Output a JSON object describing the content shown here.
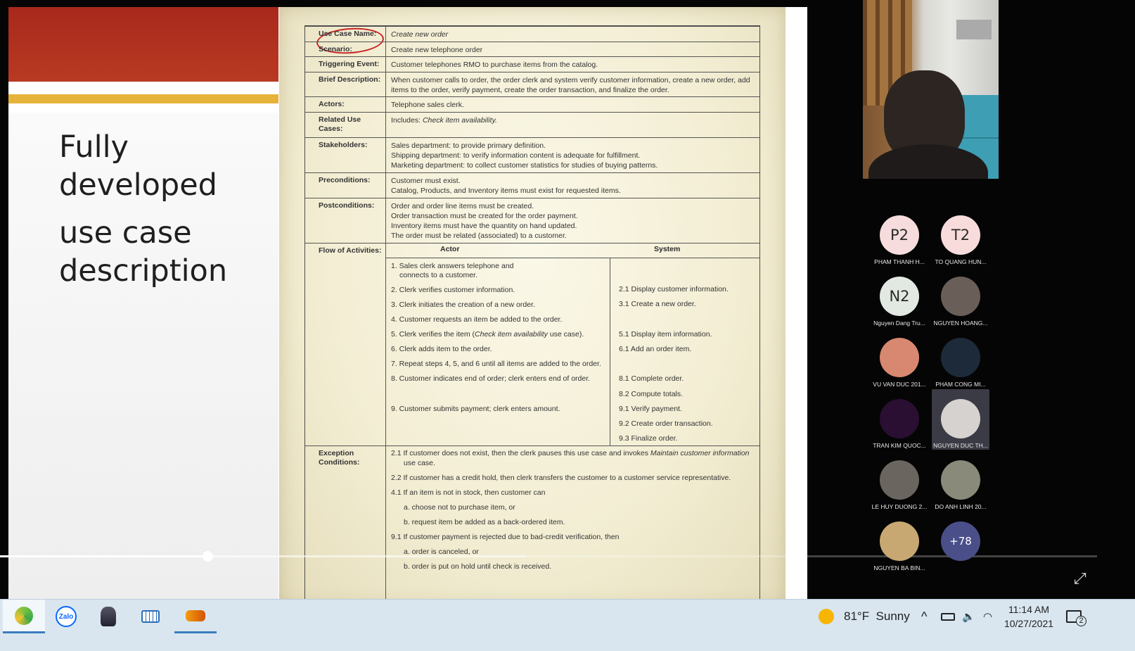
{
  "slide": {
    "title_line1": "Fully",
    "title_line2": "developed",
    "title_line3": "use case",
    "title_line4": "description"
  },
  "doc": {
    "use_case_name_label": "Use Case Name:",
    "use_case_name_value": "Create new order",
    "scenario_label": "Scenario:",
    "scenario_value": "Create new telephone order",
    "trigger_label": "Triggering Event:",
    "trigger_value": "Customer telephones RMO to purchase items from the catalog.",
    "brief_label": "Brief Description:",
    "brief_value": "When customer calls to order, the order clerk and system verify customer information, create a new order, add items to the order, verify payment, create the order transaction, and finalize the order.",
    "actors_label": "Actors:",
    "actors_value": "Telephone sales clerk.",
    "related_label": "Related Use Cases:",
    "related_prefix": "Includes: ",
    "related_value": "Check item availability.",
    "stakeholders_label": "Stakeholders:",
    "stakeholders": [
      "Sales department: to provide primary definition.",
      "Shipping department: to verify information content is adequate for fulfillment.",
      "Marketing department: to collect customer statistics for studies of buying patterns."
    ],
    "pre_label": "Preconditions:",
    "preconditions": [
      "Customer must exist.",
      "Catalog, Products, and Inventory items must exist for requested items."
    ],
    "post_label": "Postconditions:",
    "postconditions": [
      "Order and order line items must be created.",
      "Order transaction must be created for the order payment.",
      "Inventory items must have the quantity on hand updated.",
      "The order must be related (associated) to a customer."
    ],
    "flow_label": "Flow of Activities:",
    "flow_actor_header": "Actor",
    "flow_system_header": "System",
    "actor_steps": [
      "1. Sales clerk answers telephone and",
      "connects to a customer.",
      "2. Clerk verifies customer information.",
      "3. Clerk initiates the creation of a new order.",
      "4. Customer requests an item be added to the order.",
      "5. Clerk verifies the item (",
      "Check item availability",
      " use case).",
      "6. Clerk adds item to the order.",
      "7. Repeat steps 4, 5, and 6 until all items are added to the order.",
      "8. Customer indicates end of order; clerk enters end of order.",
      "9. Customer submits payment; clerk enters amount."
    ],
    "system_steps": [
      "2.1 Display customer information.",
      "3.1 Create a new order.",
      "5.1 Display item information.",
      "6.1 Add an order item.",
      "8.1 Complete order.",
      "8.2 Compute totals.",
      "9.1 Verify payment.",
      "9.2 Create order transaction.",
      "9.3 Finalize order."
    ],
    "exc_label": "Exception Conditions:",
    "exceptions": [
      "2.1 If customer does not exist, then the clerk pauses this use case and invokes ",
      "Maintain customer information",
      "use case.",
      "2.2 If customer has a credit hold, then clerk transfers the customer to a customer service representative.",
      "4.1 If an item is not in stock, then customer can",
      "a. choose not to purchase item, or",
      "b. request item be added as a back-ordered item.",
      "9.1 If customer payment is rejected due to bad-credit verification, then",
      "a. order is canceled, or",
      "b. order is put on hold until check is received."
    ]
  },
  "player": {
    "progress_percent": 19,
    "buffer_percent": 48
  },
  "participants": [
    {
      "initials": "P2",
      "name": "PHAM THANH H...",
      "color": "#f6dcdc"
    },
    {
      "initials": "T2",
      "name": "TO QUANG HUN...",
      "color": "#f8dcdc"
    },
    {
      "initials": "N2",
      "name": "Nguyen Dang Tru...",
      "color": "#e2e8e2"
    },
    {
      "initials": "",
      "name": "NGUYEN HOANG...",
      "color": "#6a5e58"
    },
    {
      "initials": "",
      "name": "VU VAN DUC 201...",
      "color": "#d88870"
    },
    {
      "initials": "",
      "name": "PHAM CONG MI...",
      "color": "#1d2a3a"
    },
    {
      "initials": "",
      "name": "TRAN KIM QUOC...",
      "color": "#2a0f32"
    },
    {
      "initials": "",
      "name": "NGUYEN DUC TH...",
      "color": "#d6d2d0"
    },
    {
      "initials": "",
      "name": "LE HUY DUONG 2...",
      "color": "#6b6560"
    },
    {
      "initials": "",
      "name": "DO ANH LINH 20...",
      "color": "#8a8a7a"
    },
    {
      "initials": "",
      "name": "NGUYEN BA BIN...",
      "color": "#c8a872"
    },
    {
      "initials": "+78",
      "name": "",
      "color": "#4a4f8a"
    }
  ],
  "taskbar": {
    "apps": [
      "coccoc-icon",
      "zalo-icon",
      "ultraviewer-icon",
      "keyboard-icon",
      "game-icon"
    ],
    "zalo_label": "Zalo",
    "weather": "81°F  Sunny",
    "time": "11:14 AM",
    "date": "10/27/2021",
    "notifications": "2"
  }
}
